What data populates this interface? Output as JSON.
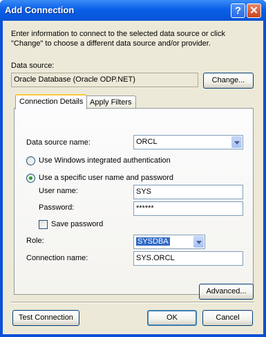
{
  "window": {
    "title": "Add Connection",
    "help_glyph": "?",
    "close_glyph": "✕"
  },
  "intro": {
    "line1": "Enter information to connect to the selected data source or click",
    "line2": "\"Change\" to choose a different data source and/or provider."
  },
  "data_source": {
    "label": "Data source:",
    "value": "Oracle Database (Oracle ODP.NET)",
    "change_button": "Change..."
  },
  "tabs": [
    {
      "label": "Connection Details",
      "active": true
    },
    {
      "label": "Apply Filters",
      "active": false
    }
  ],
  "details": {
    "dsn_label": "Data source name:",
    "dsn_value": "ORCL",
    "auth_windows": "Use Windows integrated authentication",
    "auth_specific": "Use a specific user name and password",
    "username_label": "User name:",
    "username_value": "SYS",
    "password_label": "Password:",
    "password_value": "******",
    "save_password": "Save password",
    "role_label": "Role:",
    "role_value": "SYSDBA",
    "connection_name_label": "Connection name:",
    "connection_name_value": "SYS.ORCL"
  },
  "buttons": {
    "advanced": "Advanced...",
    "test": "Test Connection",
    "ok": "OK",
    "cancel": "Cancel"
  }
}
